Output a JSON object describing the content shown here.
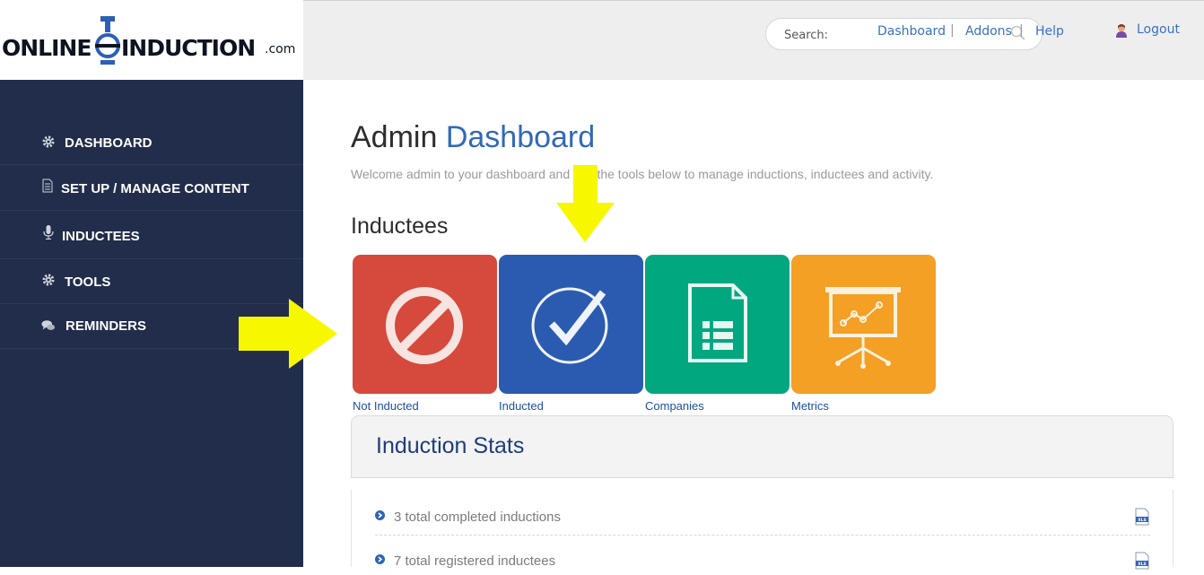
{
  "header": {
    "logo": {
      "text_left": "ONLINE",
      "text_right": "INDUCTION",
      "suffix": ".com"
    },
    "search": {
      "placeholder": "Search:"
    },
    "links": [
      {
        "label": "Dashboard"
      },
      {
        "label": "Addons"
      },
      {
        "label": "Help"
      }
    ],
    "separator": "|",
    "logout_label": "Logout"
  },
  "sidebar": {
    "items": [
      {
        "label": "DASHBOARD",
        "icon": "gear-icon"
      },
      {
        "label": "SET UP / MANAGE CONTENT",
        "icon": "document-icon"
      },
      {
        "label": "INDUCTEES",
        "icon": "microphone-icon"
      },
      {
        "label": "TOOLS",
        "icon": "gear-icon"
      },
      {
        "label": "REMINDERS",
        "icon": "chat-bubbles-icon"
      }
    ]
  },
  "main": {
    "title_part1": "Admin",
    "title_part2": "Dashboard",
    "welcome": "Welcome admin to your dashboard and use the tools below to manage inductions, inductees and activity.",
    "section_heading": "Inductees",
    "tiles": [
      {
        "label": "Not Inducted",
        "icon": "prohibited-icon",
        "color": "#d54a3c"
      },
      {
        "label": "Inducted",
        "icon": "check-circle-icon",
        "color": "#2b5bb0"
      },
      {
        "label": "Companies",
        "icon": "spreadsheet-icon",
        "color": "#00a77f"
      },
      {
        "label": "Metrics",
        "icon": "presentation-chart-icon",
        "color": "#f4a024"
      }
    ]
  },
  "stats": {
    "title": "Induction Stats",
    "items": [
      {
        "text": "3 total completed inductions",
        "icon": "xls-icon"
      },
      {
        "text": "7 total registered inductees",
        "icon": "xls-icon"
      }
    ]
  },
  "colors": {
    "sidebar_bg": "#212d4a",
    "topbar_bg": "#eeeeef",
    "accent_blue": "#3269b7",
    "annotation_arrow": "#f7f700"
  }
}
